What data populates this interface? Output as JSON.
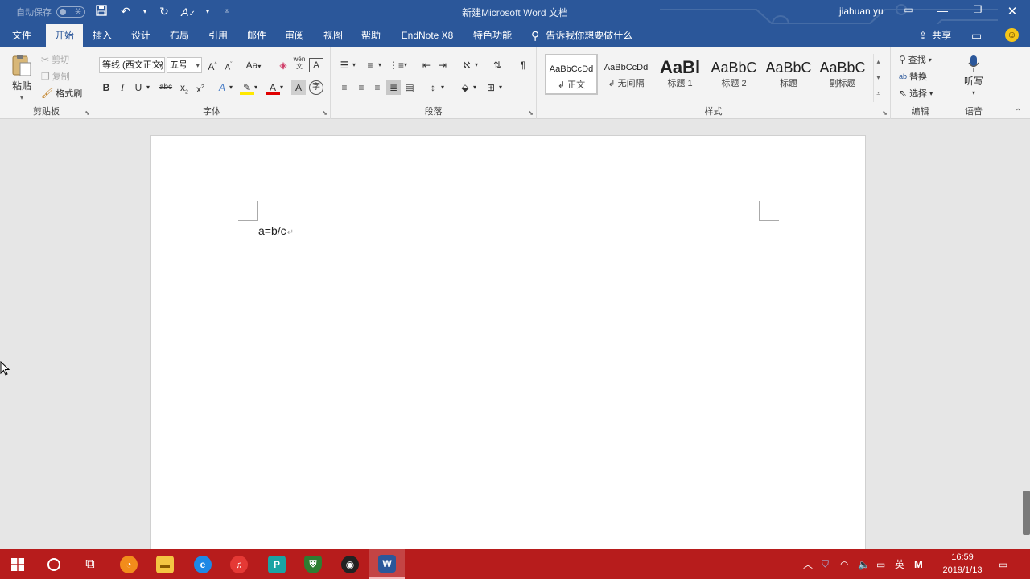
{
  "titlebar": {
    "autosave_label": "自动保存",
    "autosave_state": "关",
    "doc_title": "新建Microsoft Word 文档",
    "user": "jiahuan yu"
  },
  "tabs": [
    {
      "label": "文件"
    },
    {
      "label": "开始"
    },
    {
      "label": "插入"
    },
    {
      "label": "设计"
    },
    {
      "label": "布局"
    },
    {
      "label": "引用"
    },
    {
      "label": "邮件"
    },
    {
      "label": "审阅"
    },
    {
      "label": "视图"
    },
    {
      "label": "帮助"
    },
    {
      "label": "EndNote X8"
    },
    {
      "label": "特色功能"
    }
  ],
  "tellme": "告诉我你想要做什么",
  "share": "共享",
  "clipboard": {
    "paste": "粘贴",
    "cut": "剪切",
    "copy": "复制",
    "format_painter": "格式刷",
    "label": "剪贴板"
  },
  "font": {
    "family": "等线 (西文正文)",
    "size": "五号",
    "label": "字体",
    "aa": "Aa",
    "wen": "wén"
  },
  "paragraph": {
    "label": "段落"
  },
  "styles": {
    "label": "样式",
    "items": [
      {
        "sample": "AaBbCcDd",
        "name": "正文"
      },
      {
        "sample": "AaBbCcDd",
        "name": "无间隔"
      },
      {
        "sample": "AaBl",
        "name": "标题 1"
      },
      {
        "sample": "AaBbC",
        "name": "标题 2"
      },
      {
        "sample": "AaBbC",
        "name": "标题"
      },
      {
        "sample": "AaBbC",
        "name": "副标题"
      }
    ]
  },
  "editing": {
    "find": "查找",
    "replace": "替换",
    "select": "选择",
    "label": "编辑"
  },
  "voice": {
    "dictate": "听写",
    "label": "语音"
  },
  "document": {
    "text": "a=b/c",
    "para_mark": "↵"
  },
  "taskbar": {
    "ime": "英",
    "time": "16:59",
    "date": "2019/1/13",
    "accent": "#b71c1c"
  },
  "colors": {
    "word_blue": "#2b579a",
    "ribbon_bg": "#f3f3f3",
    "canvas_bg": "#e6e6e6"
  }
}
